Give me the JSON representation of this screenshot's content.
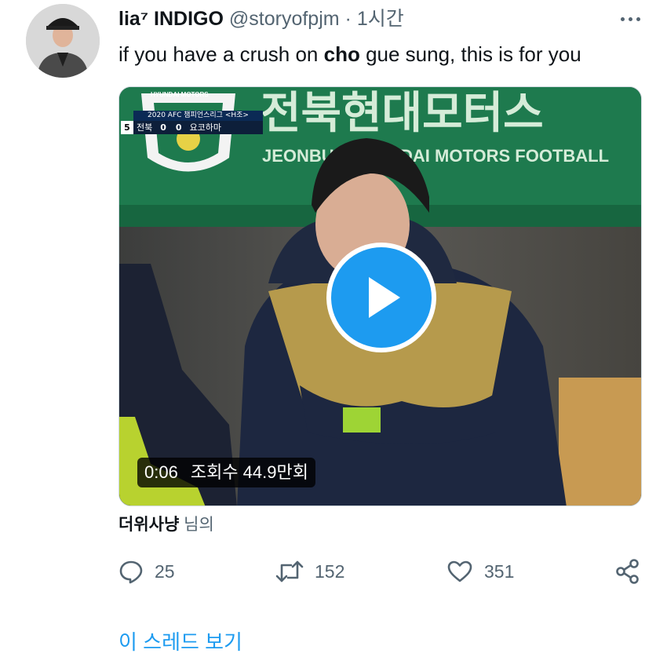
{
  "tweet": {
    "author_name": "lia⁷ INDIGO",
    "handle": "@storyofpjm",
    "separator": "·",
    "time": "1시간",
    "text_before": "if you have a crush on ",
    "text_bold": "cho",
    "text_after": " gue sung, this is for you"
  },
  "media": {
    "banner_korean": "전북현대모터스",
    "banner_english": "JEONBUK HYUNDAI MOTORS FOOTBALL",
    "crest_text": "HYUNDAI MOTORS",
    "scorebar": {
      "competition": "2020 AFC 챔피언스리그 <H조>",
      "minute": "5",
      "home_team": "전북",
      "home_score": "0",
      "away_score": "0",
      "away_team": "요코하마"
    },
    "duration": "0:06",
    "views": "조회수 44.9만회"
  },
  "attribution": {
    "user": "더위사냥",
    "suffix": "님의"
  },
  "actions": {
    "replies": "25",
    "retweets": "152",
    "likes": "351"
  },
  "thread_link": "이 스레드 보기",
  "colors": {
    "accent": "#1d9bf0",
    "secondary_text": "#536471",
    "banner_green": "#1e7a4e"
  }
}
